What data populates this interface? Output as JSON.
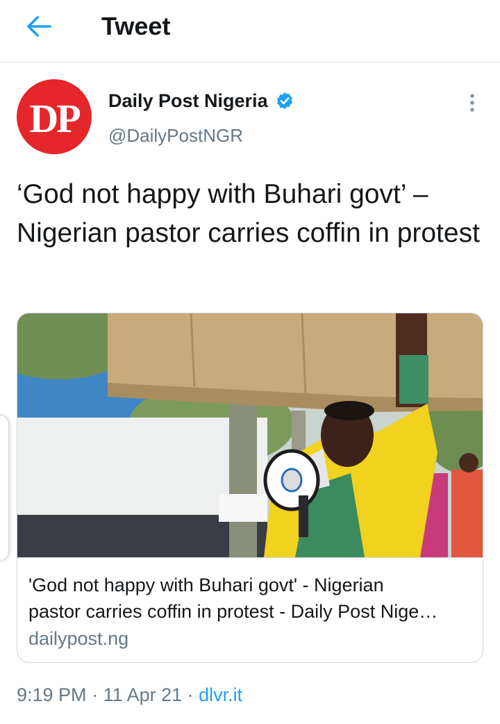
{
  "header": {
    "title": "Tweet",
    "back_icon": "arrow-left-icon"
  },
  "author": {
    "avatar_text": "DP",
    "display_name": "Daily Post Nigeria",
    "handle": "@DailyPostNGR",
    "verified": true,
    "verified_icon": "verified-badge-icon",
    "more_icon": "more-vertical-icon"
  },
  "tweet": {
    "text": "‘God not happy with Buhari govt’ – Nigerian pastor carries coffin in protest"
  },
  "card": {
    "image_alt": "photo",
    "title_line1": "'God not happy with Buhari govt' - Nigerian",
    "title_line2": "pastor carries coffin in protest - Daily Post Nige…",
    "domain": "dailypost.ng"
  },
  "meta": {
    "time": "9:19 PM",
    "sep1": " · ",
    "date": "11 Apr 21",
    "sep2": " · ",
    "source": "dlvr.it"
  },
  "colors": {
    "accent": "#1da1f2",
    "avatar_bg": "#e5262a",
    "secondary_text": "#657786",
    "border": "#ccd6dd"
  }
}
